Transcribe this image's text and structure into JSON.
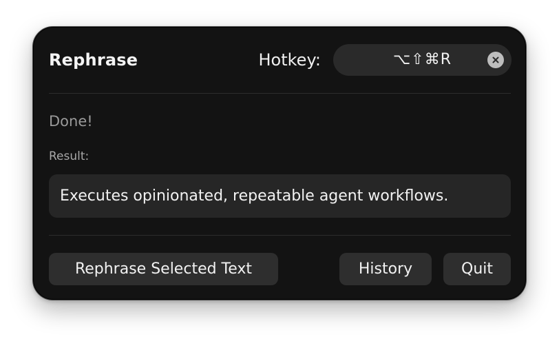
{
  "header": {
    "title": "Rephrase",
    "hotkey_label": "Hotkey:",
    "hotkey_value": "⌥⇧⌘R",
    "clear_icon": "xmark-circle-icon"
  },
  "status": {
    "text": "Done!"
  },
  "result": {
    "label": "Result:",
    "text": "Executes opinionated, repeatable agent workflows."
  },
  "footer": {
    "rephrase_label": "Rephrase Selected Text",
    "history_label": "History",
    "quit_label": "Quit"
  },
  "colors": {
    "panel_background": "#131313",
    "control_background": "#2e2e2e",
    "primary_text": "#f2f2f2",
    "secondary_text": "#9a9a9a"
  }
}
